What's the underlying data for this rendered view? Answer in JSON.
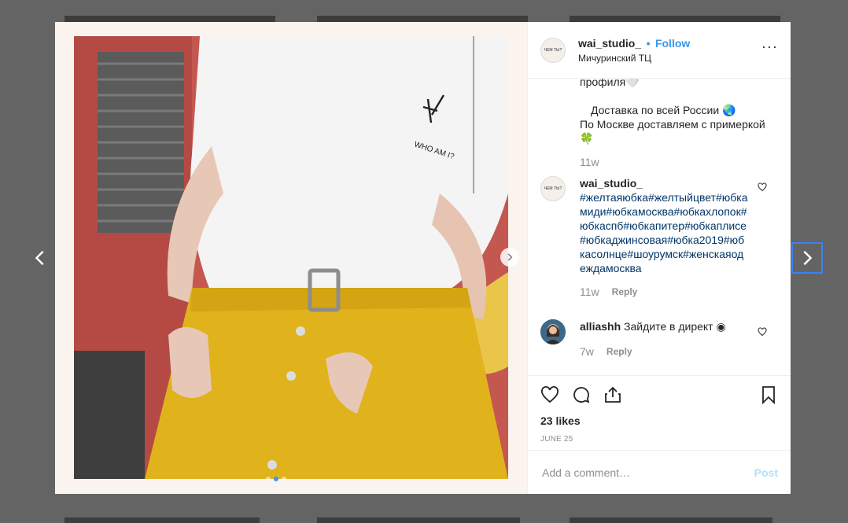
{
  "post": {
    "username": "wai_studio_",
    "follow_sep": "•",
    "follow_label": "Follow",
    "location": "Мичуринский ТЦ",
    "more_label": "···",
    "avatar_text": "ЧЕМ ТЫ?"
  },
  "caption": {
    "line1": "профиля🤍",
    "line2": "Доставка по всей России 🌏",
    "line3": "По Москве доставляем с примеркой",
    "line4": "🍀",
    "time": "11w"
  },
  "comments": [
    {
      "username": "wai_studio_",
      "text": "#желтаяюбка#желтыйцвет#юбкамиди#юбкамосква#юбкахлопок#юбкаспб#юбкапитер#юбкаплисе#юбкаджинсовая#юбка2019#юбкасолнце#шоурумск#женскаяодеждамосква",
      "time": "11w",
      "reply": "Reply"
    },
    {
      "username": "alliashh",
      "text": "Зайдите в директ ◉",
      "time": "7w",
      "reply": "Reply"
    }
  ],
  "likes": "23 likes",
  "date": "JUNE 25",
  "add_comment": {
    "placeholder": "Add a comment…",
    "post_label": "Post"
  },
  "icons": [
    "chevron-left-icon",
    "chevron-right-icon",
    "heart-icon",
    "comment-icon",
    "share-icon",
    "bookmark-icon"
  ],
  "colors": {
    "link": "#3897f0",
    "post_disabled": "#b2dffc",
    "skirt": "#e0b21c"
  }
}
